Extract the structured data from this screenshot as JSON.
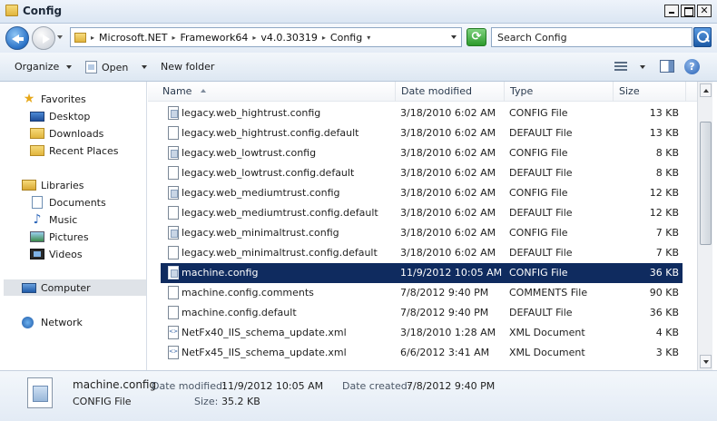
{
  "window": {
    "title": "Config"
  },
  "address": {
    "crumbs": [
      "Microsoft.NET",
      "Framework64",
      "v4.0.30319",
      "Config"
    ]
  },
  "search": {
    "placeholder": "Search Config"
  },
  "toolbar": {
    "organize": "Organize",
    "open": "Open",
    "new_folder": "New folder"
  },
  "nav": {
    "favorites": "Favorites",
    "desktop": "Desktop",
    "downloads": "Downloads",
    "recent_places": "Recent Places",
    "libraries": "Libraries",
    "documents": "Documents",
    "music": "Music",
    "pictures": "Pictures",
    "videos": "Videos",
    "computer": "Computer",
    "network": "Network"
  },
  "columns": {
    "name": "Name",
    "date_modified": "Date modified",
    "type": "Type",
    "size": "Size"
  },
  "files": [
    {
      "name": "legacy.web_hightrust.config",
      "date": "3/18/2010 6:02 AM",
      "type": "CONFIG File",
      "size": "13 KB",
      "icon": "config-file-icon"
    },
    {
      "name": "legacy.web_hightrust.config.default",
      "date": "3/18/2010 6:02 AM",
      "type": "DEFAULT File",
      "size": "13 KB",
      "icon": "file-icon"
    },
    {
      "name": "legacy.web_lowtrust.config",
      "date": "3/18/2010 6:02 AM",
      "type": "CONFIG File",
      "size": "8 KB",
      "icon": "config-file-icon"
    },
    {
      "name": "legacy.web_lowtrust.config.default",
      "date": "3/18/2010 6:02 AM",
      "type": "DEFAULT File",
      "size": "8 KB",
      "icon": "file-icon"
    },
    {
      "name": "legacy.web_mediumtrust.config",
      "date": "3/18/2010 6:02 AM",
      "type": "CONFIG File",
      "size": "12 KB",
      "icon": "config-file-icon"
    },
    {
      "name": "legacy.web_mediumtrust.config.default",
      "date": "3/18/2010 6:02 AM",
      "type": "DEFAULT File",
      "size": "12 KB",
      "icon": "file-icon"
    },
    {
      "name": "legacy.web_minimaltrust.config",
      "date": "3/18/2010 6:02 AM",
      "type": "CONFIG File",
      "size": "7 KB",
      "icon": "config-file-icon"
    },
    {
      "name": "legacy.web_minimaltrust.config.default",
      "date": "3/18/2010 6:02 AM",
      "type": "DEFAULT File",
      "size": "7 KB",
      "icon": "file-icon"
    },
    {
      "name": "machine.config",
      "date": "11/9/2012 10:05 AM",
      "type": "CONFIG File",
      "size": "36 KB",
      "icon": "config-file-icon",
      "selected": true
    },
    {
      "name": "machine.config.comments",
      "date": "7/8/2012 9:40 PM",
      "type": "COMMENTS File",
      "size": "90 KB",
      "icon": "file-icon"
    },
    {
      "name": "machine.config.default",
      "date": "7/8/2012 9:40 PM",
      "type": "DEFAULT File",
      "size": "36 KB",
      "icon": "file-icon"
    },
    {
      "name": "NetFx40_IIS_schema_update.xml",
      "date": "3/18/2010 1:28 AM",
      "type": "XML Document",
      "size": "4 KB",
      "icon": "xml-file-icon"
    },
    {
      "name": "NetFx45_IIS_schema_update.xml",
      "date": "6/6/2012 3:41 AM",
      "type": "XML Document",
      "size": "3 KB",
      "icon": "xml-file-icon"
    }
  ],
  "details": {
    "name": "machine.config",
    "type": "CONFIG File",
    "modified_label": "Date modified:",
    "modified_value": "11/9/2012 10:05 AM",
    "created_label": "Date created:",
    "created_value": "7/8/2012 9:40 PM",
    "size_label": "Size:",
    "size_value": "35.2 KB"
  }
}
